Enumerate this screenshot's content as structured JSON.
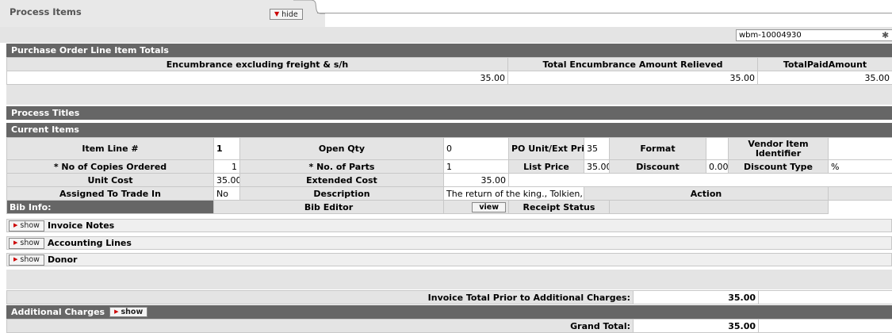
{
  "tab": {
    "title": "Process Items",
    "hide_label": "hide"
  },
  "document_number": "wbm-10004930",
  "totals": {
    "section_title": "Purchase Order Line Item Totals",
    "headers": [
      "Encumbrance excluding freight & s/h",
      "Total Encumbrance Amount Relieved",
      "TotalPaidAmount"
    ],
    "values": [
      "35.00",
      "35.00",
      "35.00"
    ]
  },
  "process_titles": "Process Titles",
  "current_items": {
    "title": "Current Items",
    "item_line_label": "Item Line #",
    "item_line_value": "1",
    "open_qty_label": "Open Qty",
    "open_qty_value": "0",
    "po_unit_label": "PO Unit/Ext Price",
    "po_unit_value": "35",
    "format_label": "Format",
    "format_value": "",
    "vendor_item_label": "Vendor Item Identifier",
    "vendor_item_value": "",
    "copies_label": "* No of Copies Ordered",
    "copies_value": "1",
    "parts_label": "* No. of Parts",
    "parts_value": "1",
    "list_price_label": "List Price",
    "list_price_value": "35.00",
    "discount_label": "Discount",
    "discount_value": "0.00",
    "discount_type_label": "Discount Type",
    "discount_type_value": "%",
    "unit_cost_label": "Unit Cost",
    "unit_cost_value": "35.00",
    "ext_cost_label": "Extended Cost",
    "ext_cost_value": "35.00",
    "trade_in_label": "Assigned To Trade In",
    "trade_in_value": "No",
    "description_label": "Description",
    "description_value": "The return of the king., Tolkien, J. R. R.",
    "action_label": "Action",
    "bib_info_label": "Bib Info:",
    "bib_editor_label": "Bib Editor",
    "view_label": "view",
    "receipt_status_label": "Receipt Status"
  },
  "collapsibles": [
    {
      "show_label": "show",
      "label": "Invoice Notes"
    },
    {
      "show_label": "show",
      "label": "Accounting Lines"
    },
    {
      "show_label": "show",
      "label": "Donor"
    }
  ],
  "invoice_total": {
    "label": "Invoice Total Prior to Additional Charges:",
    "value": "35.00"
  },
  "additional_charges": {
    "label": "Additional Charges",
    "show_label": "show"
  },
  "grand_total": {
    "label": "Grand Total:",
    "value": "35.00"
  },
  "colors": {
    "header_gray": "#666666",
    "label_gray": "#e4e4e4",
    "accent_red": "#cc0000"
  }
}
